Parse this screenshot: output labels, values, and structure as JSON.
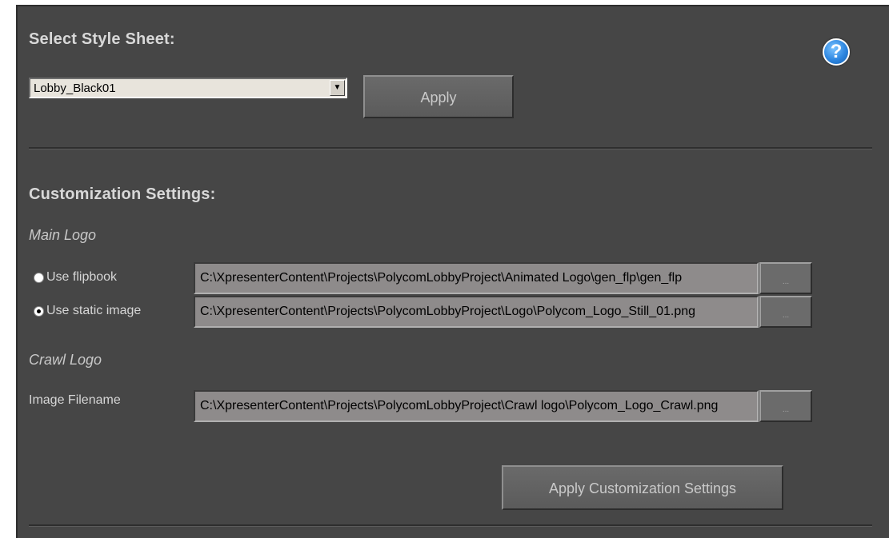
{
  "style_sheet": {
    "title": "Select Style Sheet:",
    "selected": "Lobby_Black01",
    "apply_label": "Apply"
  },
  "customization": {
    "title": "Customization Settings:",
    "main_logo": {
      "title": "Main Logo",
      "flipbook_label": "Use flipbook",
      "flipbook_path": "C:\\XpresenterContent\\Projects\\PolycomLobbyProject\\Animated Logo\\gen_flp\\gen_flp",
      "static_label": "Use static image",
      "static_path": "C:\\XpresenterContent\\Projects\\PolycomLobbyProject\\Logo\\Polycom_Logo_Still_01.png",
      "selected": "static"
    },
    "crawl_logo": {
      "title": "Crawl Logo",
      "filename_label": "Image Filename",
      "path": "C:\\XpresenterContent\\Projects\\PolycomLobbyProject\\Crawl logo\\Polycom_Logo_Crawl.png"
    },
    "browse_label": "...",
    "apply_label": "Apply Customization Settings"
  },
  "help": {
    "icon": "help-question-icon",
    "glyph": "?"
  }
}
